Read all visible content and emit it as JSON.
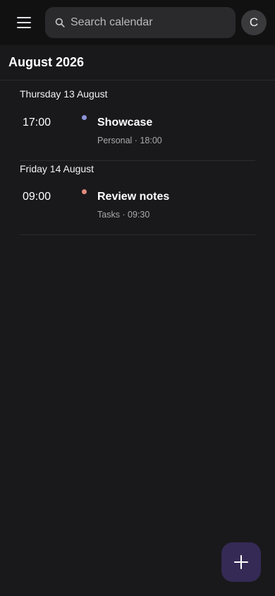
{
  "search": {
    "placeholder": "Search calendar"
  },
  "user": {
    "initial": "C"
  },
  "month": {
    "title": "August 2026"
  },
  "days": [
    {
      "label": "Thursday 13 August",
      "events": [
        {
          "time": "17:00",
          "title": "Showcase",
          "meta": "Personal · 18:00",
          "dot_color": "#8d93d8"
        }
      ]
    },
    {
      "label": "Friday 14 August",
      "events": [
        {
          "time": "09:00",
          "title": "Review notes",
          "meta": "Tasks · 09:30",
          "dot_color": "#e08a7e"
        }
      ]
    }
  ],
  "colors": {
    "background": "#19191b",
    "topbar": "#111112",
    "fab": "#352a55"
  },
  "icons": {
    "menu": "hamburger-menu-icon",
    "search": "search-icon",
    "add": "plus-icon"
  }
}
